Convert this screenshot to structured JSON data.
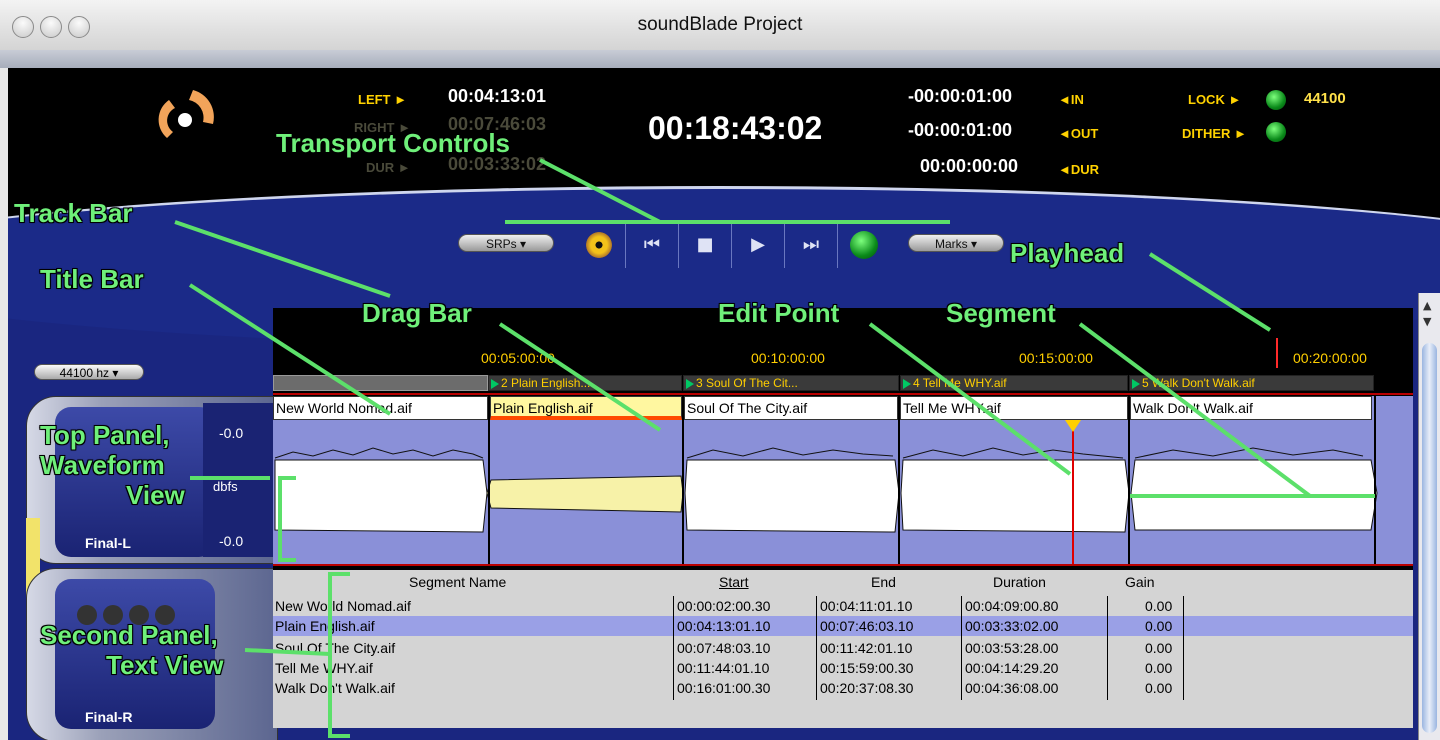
{
  "window": {
    "title": "soundBlade Project"
  },
  "transport": {
    "left_label": "LEFT",
    "left_value": "00:04:13:01",
    "right_label": "RIGHT",
    "right_value": "00:07:46:03",
    "dur_label": "DUR",
    "dur_value": "00:03:33:02",
    "main_time": "00:18:43:02",
    "in_value": "-00:00:01:00",
    "in_label": "IN",
    "out_value": "-00:00:01:00",
    "out_label": "OUT",
    "dur2_value": "00:00:00:00",
    "dur2_label": "DUR",
    "lock_label": "LOCK",
    "sample_rate": "44100",
    "dither_label": "DITHER",
    "srps_label": "SRPs",
    "marks_label": "Marks"
  },
  "sidebar": {
    "hz_select": "44100 hz",
    "top_channel": "Final-L",
    "second_channel": "Final-R",
    "db_top": "-0.0",
    "dbfs": "dbfs",
    "db_bottom": "-0.0"
  },
  "ruler": {
    "ticks": [
      "00:05:00:00",
      "00:10:00:00",
      "00:15:00:00",
      "00:20:00:00"
    ]
  },
  "track_bar": {
    "tabs": [
      "2 Plain English....",
      "3 Soul Of The Cit...",
      "4 Tell Me WHY.aif",
      "5 Walk Don't Walk.aif"
    ]
  },
  "segments": {
    "titles": [
      "New World Nomad.aif",
      "Plain English.aif",
      "Soul Of The City.aif",
      "Tell Me WHY.aif",
      "Walk Don't Walk.aif"
    ]
  },
  "text_view": {
    "headers": {
      "name": "Segment Name",
      "start": "Start",
      "end": "End",
      "duration": "Duration",
      "gain": "Gain"
    },
    "rows": [
      {
        "name": "New World Nomad.aif",
        "start": "00:00:02:00.30",
        "end": "00:04:11:01.10",
        "duration": "00:04:09:00.80",
        "gain": "0.00"
      },
      {
        "name": "Plain English.aif",
        "start": "00:04:13:01.10",
        "end": "00:07:46:03.10",
        "duration": "00:03:33:02.00",
        "gain": "0.00"
      },
      {
        "name": "Soul Of The City.aif",
        "start": "00:07:48:03.10",
        "end": "00:11:42:01.10",
        "duration": "00:03:53:28.00",
        "gain": "0.00"
      },
      {
        "name": "Tell Me WHY.aif",
        "start": "00:11:44:01.10",
        "end": "00:15:59:00.30",
        "duration": "00:04:14:29.20",
        "gain": "0.00"
      },
      {
        "name": "Walk Don't Walk.aif",
        "start": "00:16:01:00.30",
        "end": "00:20:37:08.30",
        "duration": "00:04:36:08.00",
        "gain": "0.00"
      }
    ]
  },
  "annotations": {
    "transport_controls": "Transport Controls",
    "track_bar": "Track Bar",
    "title_bar": "Title Bar",
    "drag_bar": "Drag Bar",
    "edit_point": "Edit Point",
    "segment": "Segment",
    "playhead": "Playhead",
    "top_panel_1": "Top Panel,",
    "top_panel_2": "Waveform",
    "top_panel_3": "View",
    "second_panel_1": "Second Panel,",
    "second_panel_2": "Text View"
  },
  "colors": {
    "app_bg": "#1a2680",
    "label_yellow": "#ffd200",
    "annotation_green": "#6ff07a",
    "selection": "#9aa0e6",
    "wave_bg": "#8a90d8"
  }
}
